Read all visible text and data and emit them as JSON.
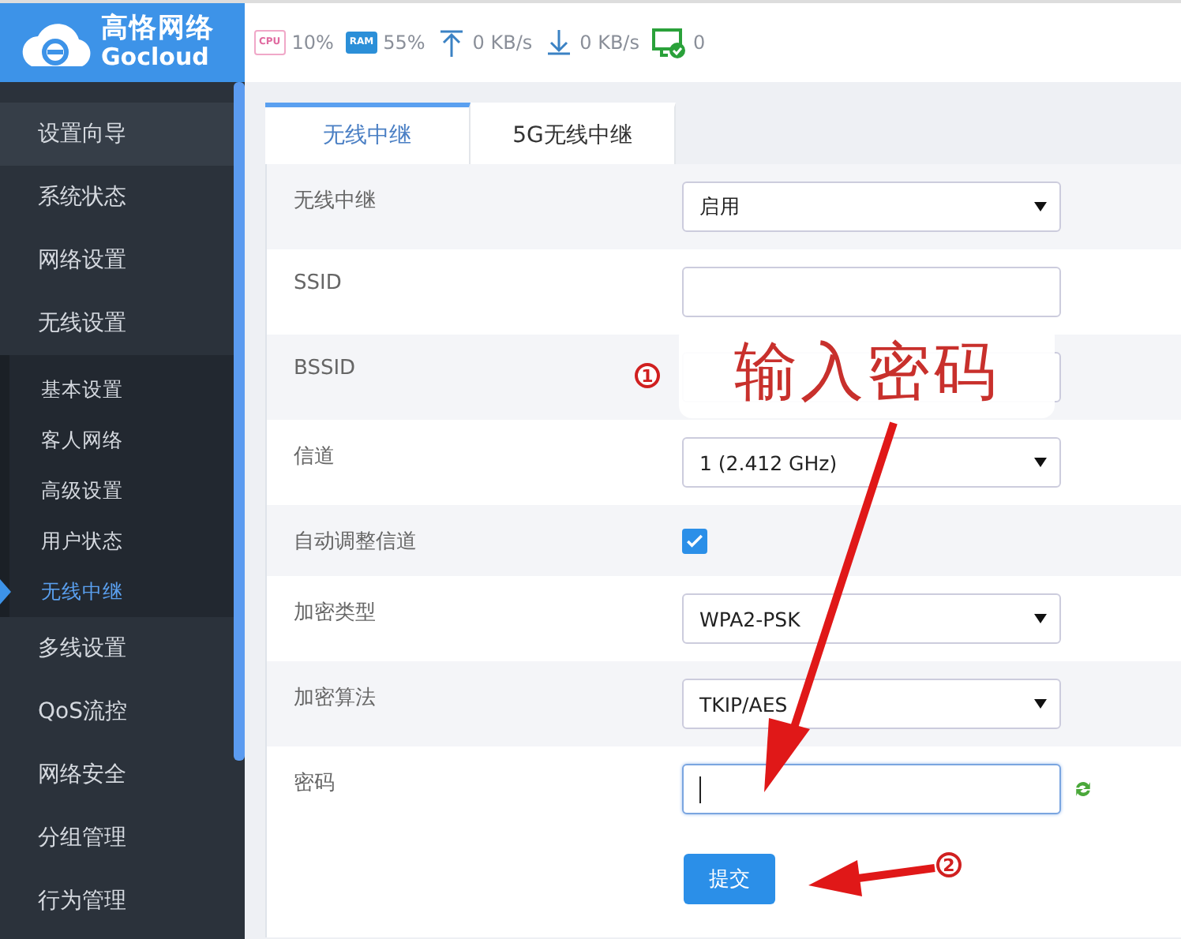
{
  "header": {
    "logo_title": "高恪网络",
    "logo_subtitle": "Gocloud",
    "stats": [
      {
        "kind": "cpu",
        "icon_text": "CPU",
        "value": "10%"
      },
      {
        "kind": "ram",
        "icon_text": "RAM",
        "value": "55%"
      },
      {
        "kind": "upload",
        "value": "0 KB/s"
      },
      {
        "kind": "download",
        "value": "0 KB/s"
      },
      {
        "kind": "clients",
        "value": "0"
      }
    ]
  },
  "sidebar": {
    "items": [
      {
        "label": "设置向导",
        "selected": false,
        "hovered": true
      },
      {
        "label": "系统状态",
        "selected": false,
        "hovered": false
      },
      {
        "label": "网络设置",
        "selected": false,
        "hovered": false
      },
      {
        "label": "无线设置",
        "selected": false,
        "hovered": false,
        "expanded": true,
        "children": [
          {
            "label": "基本设置",
            "selected": false
          },
          {
            "label": "客人网络",
            "selected": false
          },
          {
            "label": "高级设置",
            "selected": false
          },
          {
            "label": "用户状态",
            "selected": false
          },
          {
            "label": "无线中继",
            "selected": true
          }
        ]
      },
      {
        "label": "多线设置",
        "selected": false,
        "hovered": false
      },
      {
        "label": "QoS流控",
        "selected": false,
        "hovered": false
      },
      {
        "label": "网络安全",
        "selected": false,
        "hovered": false
      },
      {
        "label": "分组管理",
        "selected": false,
        "hovered": false
      },
      {
        "label": "行为管理",
        "selected": false,
        "hovered": false
      }
    ]
  },
  "tabs": [
    {
      "label": "无线中继",
      "selected": true
    },
    {
      "label": "5G无线中继",
      "selected": false
    }
  ],
  "form": {
    "rows": [
      {
        "kind": "select",
        "label": "无线中继",
        "value": "启用"
      },
      {
        "kind": "text",
        "label": "SSID"
      },
      {
        "kind": "text",
        "label": "BSSID"
      },
      {
        "kind": "select",
        "label": "信道",
        "value": "1 (2.412 GHz)"
      },
      {
        "kind": "checkbox",
        "label": "自动调整信道",
        "checked": true
      },
      {
        "kind": "select",
        "label": "加密类型",
        "value": "WPA2-PSK"
      },
      {
        "kind": "select",
        "label": "加密算法",
        "value": "TKIP/AES"
      },
      {
        "kind": "password",
        "label": "密码",
        "focused": true
      }
    ],
    "submit": "提交"
  },
  "annotations": {
    "callout": "输入密码",
    "markers": [
      "1",
      "2"
    ]
  }
}
